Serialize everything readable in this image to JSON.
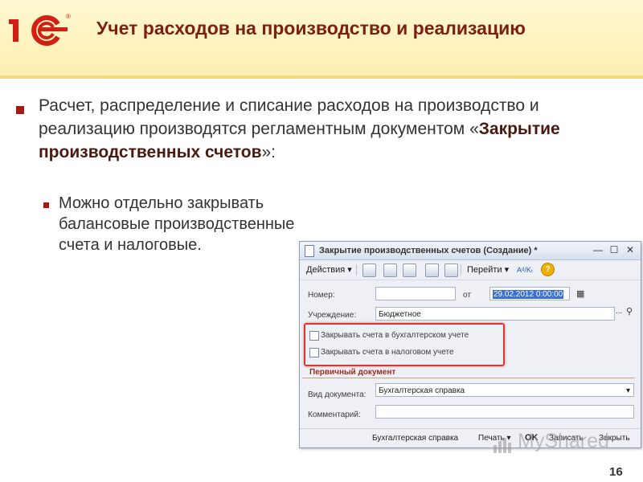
{
  "slide": {
    "title": "Учет расходов на производство и реализацию",
    "main_text_1": "Расчет, распределение и списание расходов на производство и реализацию производятся регламентным документом «",
    "main_text_bold": "Закрытие производственных счетов",
    "main_text_2": "»:",
    "sub_text": "Можно отдельно закрывать балансовые производственные счета и налоговые.",
    "page_number": "16",
    "logo_text": "1С",
    "colors": {
      "title": "#7a1f12",
      "bullet": "#a11b0e",
      "highlight": "#e8342b"
    }
  },
  "window": {
    "title": "Закрытие производственных счетов (Создание) *",
    "toolbar": {
      "actions": "Действия",
      "goto": "Перейти"
    },
    "number_label": "Номер:",
    "number_value": "",
    "from_label": "от",
    "date_value": "29.02.2012  0:00:00",
    "institution_label": "Учреждение:",
    "institution_value": "Бюджетное",
    "checkbox_1": "Закрывать счета в бухгалтерском учете",
    "checkbox_2": "Закрывать счета в налоговом учете",
    "section_label": "Первичный документ",
    "doc_type_label": "Вид документа:",
    "doc_type_value": "Бухгалтерская справка",
    "comment_label": "Комментарий:",
    "comment_value": "",
    "bottom": {
      "report": "Бухгалтерская справка",
      "print": "Печать",
      "ok": "OK",
      "save": "Записать",
      "close": "Закрыть"
    }
  },
  "watermark": "MyShared"
}
